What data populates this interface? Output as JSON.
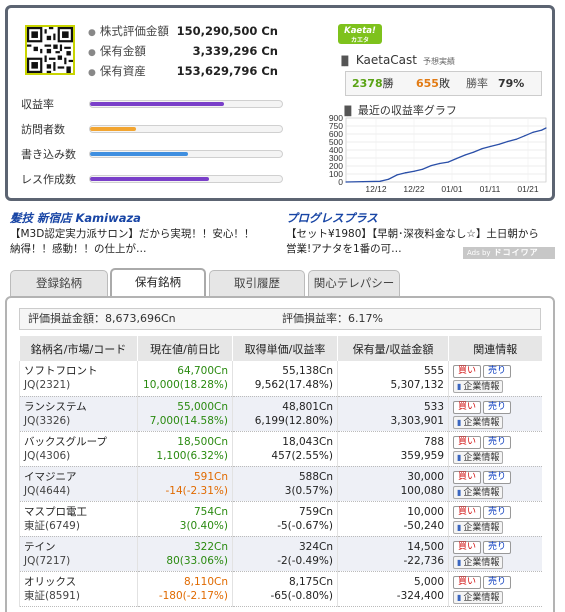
{
  "assets": [
    {
      "label": "株式評価金額",
      "value": "150,290,500 Cn"
    },
    {
      "label": "保有金額",
      "value": "3,339,296 Cn"
    },
    {
      "label": "保有資産",
      "value": "153,629,796 Cn"
    }
  ],
  "stats": [
    {
      "label": "収益率",
      "level": 0.7,
      "color": "#7a3fc9"
    },
    {
      "label": "訪問者数",
      "level": 0.24,
      "color": "#f2a531"
    },
    {
      "label": "書き込み数",
      "level": 0.51,
      "color": "#3f8fe0"
    },
    {
      "label": "レス作成数",
      "level": 0.62,
      "color": "#7a3fc9"
    }
  ],
  "kaeta": {
    "logo": "Kaeta!",
    "logo_sub": "カエタ",
    "title": "KaetaCast",
    "subtitle": "予想実績",
    "wins": "2378",
    "wins_unit": "勝",
    "losses": "655",
    "losses_unit": "敗",
    "rate_label": "勝率",
    "rate_value": "79%"
  },
  "graph": {
    "title": "最近の収益率グラフ"
  },
  "chart_data": {
    "type": "line",
    "title": "最近の収益率グラフ",
    "yticks": [
      0,
      100,
      200,
      300,
      400,
      500,
      600,
      750,
      900
    ],
    "xticks": [
      "12/12",
      "12/22",
      "01/01",
      "01/11",
      "01/21"
    ],
    "ylim": [
      0,
      900
    ],
    "grid": true,
    "series": [
      {
        "color": "#2a4fa8",
        "x": [
          0,
          4,
          8,
          10,
          12,
          14,
          16,
          18,
          20,
          22,
          24,
          26,
          28,
          30,
          32,
          34,
          36,
          38,
          40,
          42,
          44,
          46,
          47
        ],
        "values": [
          0,
          5,
          10,
          40,
          100,
          130,
          150,
          180,
          230,
          260,
          280,
          330,
          380,
          420,
          470,
          500,
          530,
          570,
          600,
          650,
          700,
          730,
          760
        ]
      }
    ]
  },
  "ads": [
    {
      "title": "髪技 新宿店 Kamiwaza",
      "desc1": "【M3D認定実力派サロン】だから実現！！安心！！",
      "desc2": "納得！！感動！！の仕上が…"
    },
    {
      "title": "プログレスプラス",
      "desc1": "【セット¥1980】【早朝･深夜料金なし☆】土日朝から",
      "desc2": "営業!アナタを1番の可…"
    }
  ],
  "ads_by": {
    "label": "Ads by",
    "brand": "ドコイワア"
  },
  "tabs": [
    "登録銘柄",
    "保有銘柄",
    "取引履歴",
    "関心テレパシー"
  ],
  "summary": {
    "gain_label": "評価損益金額：8,673,696Cn",
    "rate_label": "評価損益率：6.17%"
  },
  "table": {
    "headers": [
      "銘柄名/市場/コード",
      "現在値/前日比",
      "取得単価/収益率",
      "保有量/収益金額",
      "関連情報"
    ],
    "buy_label": "買い",
    "sell_label": "売り",
    "info_label": "企業情報",
    "rows": [
      {
        "name": "ソフトフロント",
        "code": "JQ(2321)",
        "price": "64,700Cn",
        "change": "10,000(18.28%)",
        "trend": "up",
        "cost": "55,138Cn",
        "ret": "9,562(17.48%)",
        "ret_trend": "up",
        "qty": "555",
        "profit": "5,307,132"
      },
      {
        "name": "ランシステム",
        "code": "JQ(3326)",
        "price": "55,000Cn",
        "change": "7,000(14.58%)",
        "trend": "up",
        "cost": "48,801Cn",
        "ret": "6,199(12.80%)",
        "ret_trend": "up",
        "qty": "533",
        "profit": "3,303,901"
      },
      {
        "name": "バックスグループ",
        "code": "JQ(4306)",
        "price": "18,500Cn",
        "change": "1,100(6.32%)",
        "trend": "up",
        "cost": "18,043Cn",
        "ret": "457(2.55%)",
        "ret_trend": "up",
        "qty": "788",
        "profit": "359,959"
      },
      {
        "name": "イマジニア",
        "code": "JQ(4644)",
        "price": "591Cn",
        "change": "-14(-2.31%)",
        "trend": "down",
        "cost": "588Cn",
        "ret": "3(0.57%)",
        "ret_trend": "up",
        "qty": "30,000",
        "profit": "100,080"
      },
      {
        "name": "マスプロ電工",
        "code": "東証(6749)",
        "price": "754Cn",
        "change": "3(0.40%)",
        "trend": "up",
        "cost": "759Cn",
        "ret": "-5(-0.67%)",
        "ret_trend": "neutral",
        "qty": "10,000",
        "profit": "-50,240"
      },
      {
        "name": "テイン",
        "code": "JQ(7217)",
        "price": "322Cn",
        "change": "80(33.06%)",
        "trend": "up",
        "cost": "324Cn",
        "ret": "-2(-0.49%)",
        "ret_trend": "neutral",
        "qty": "14,500",
        "profit": "-22,736"
      },
      {
        "name": "オリックス",
        "code": "東証(8591)",
        "price": "8,110Cn",
        "change": "-180(-2.17%)",
        "trend": "down",
        "cost": "8,175Cn",
        "ret": "-65(-0.80%)",
        "ret_trend": "neutral",
        "qty": "5,000",
        "profit": "-324,400"
      }
    ]
  }
}
